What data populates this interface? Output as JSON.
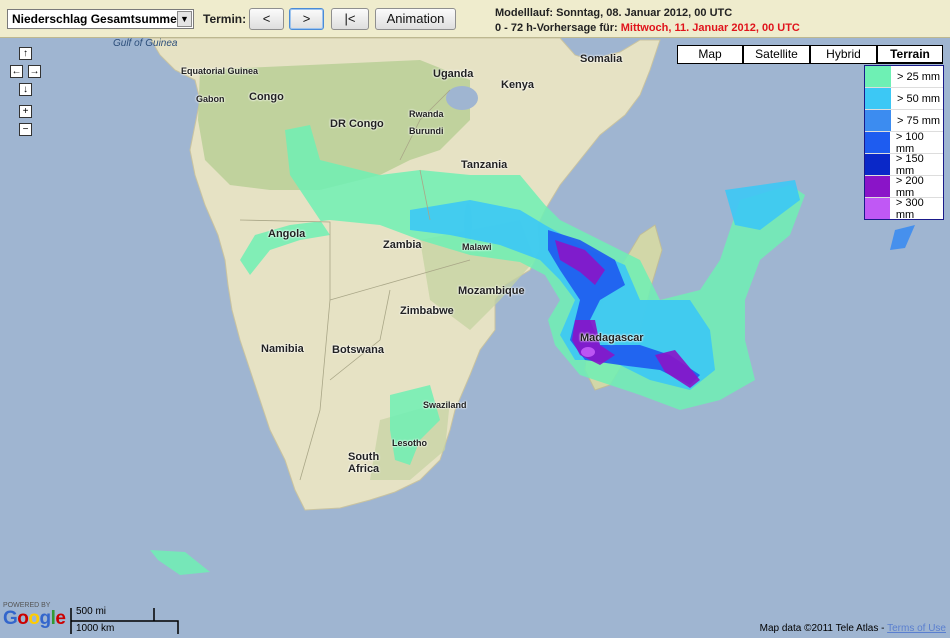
{
  "toolbar": {
    "product_select": "Niederschlag Gesamtsumme",
    "termin_label": "Termin:",
    "prev_label": "<",
    "next_label": ">",
    "first_label": "|<",
    "animation_label": "Animation",
    "modelrun_text": "Modelllauf: Sonntag, 08. Januar 2012, 00 UTC",
    "forecast_prefix": "0 - 72 h-Vorhersage für:",
    "forecast_date": "Mittwoch, 11. Januar 2012, 00 UTC"
  },
  "nav": {
    "up": "↑",
    "left": "←",
    "right": "→",
    "down": "↓",
    "zoom_in": "+",
    "zoom_out": "−"
  },
  "map_types": [
    {
      "label": "Map",
      "active": false
    },
    {
      "label": "Satellite",
      "active": false
    },
    {
      "label": "Hybrid",
      "active": false
    },
    {
      "label": "Terrain",
      "active": true
    }
  ],
  "legend": [
    {
      "label": "> 25 mm",
      "color": "#6ef0b4"
    },
    {
      "label": "> 50 mm",
      "color": "#3cc8f5"
    },
    {
      "label": "> 75 mm",
      "color": "#3c8cf0"
    },
    {
      "label": "> 100 mm",
      "color": "#1e5cf0"
    },
    {
      "label": "> 150 mm",
      "color": "#0a28c8"
    },
    {
      "label": "> 200 mm",
      "color": "#8a14c8"
    },
    {
      "label": "> 300 mm",
      "color": "#c058f5"
    }
  ],
  "places": {
    "gulf": "Gulf of Guinea",
    "eqguinea": "Equatorial Guinea",
    "gabon": "Gabon",
    "congo": "Congo",
    "drcongo": "DR Congo",
    "uganda": "Uganda",
    "kenya": "Kenya",
    "somalia": "Somalia",
    "rwanda": "Rwanda",
    "burundi": "Burundi",
    "tanzania": "Tanzania",
    "angola": "Angola",
    "zambia": "Zambia",
    "malawi": "Malawi",
    "mozambique": "Mozambique",
    "zimbabwe": "Zimbabwe",
    "namibia": "Namibia",
    "botswana": "Botswana",
    "madagascar": "Madagascar",
    "swaziland": "Swaziland",
    "lesotho": "Lesotho",
    "southafrica1": "South",
    "southafrica2": "Africa"
  },
  "footer": {
    "powered_by": "POWERED BY",
    "logo": "Google",
    "scale_mi": "500 mi",
    "scale_km": "1000 km",
    "attribution": "Map data ©2011 Tele Atlas -",
    "terms": "Terms of Use"
  },
  "colors": {
    "ocean": "#9fb5d1",
    "land": "#e8e4c8",
    "vegetation": "#b8cf94",
    "toolbar": "#efeccd",
    "forecast_red": "#e0141c"
  }
}
